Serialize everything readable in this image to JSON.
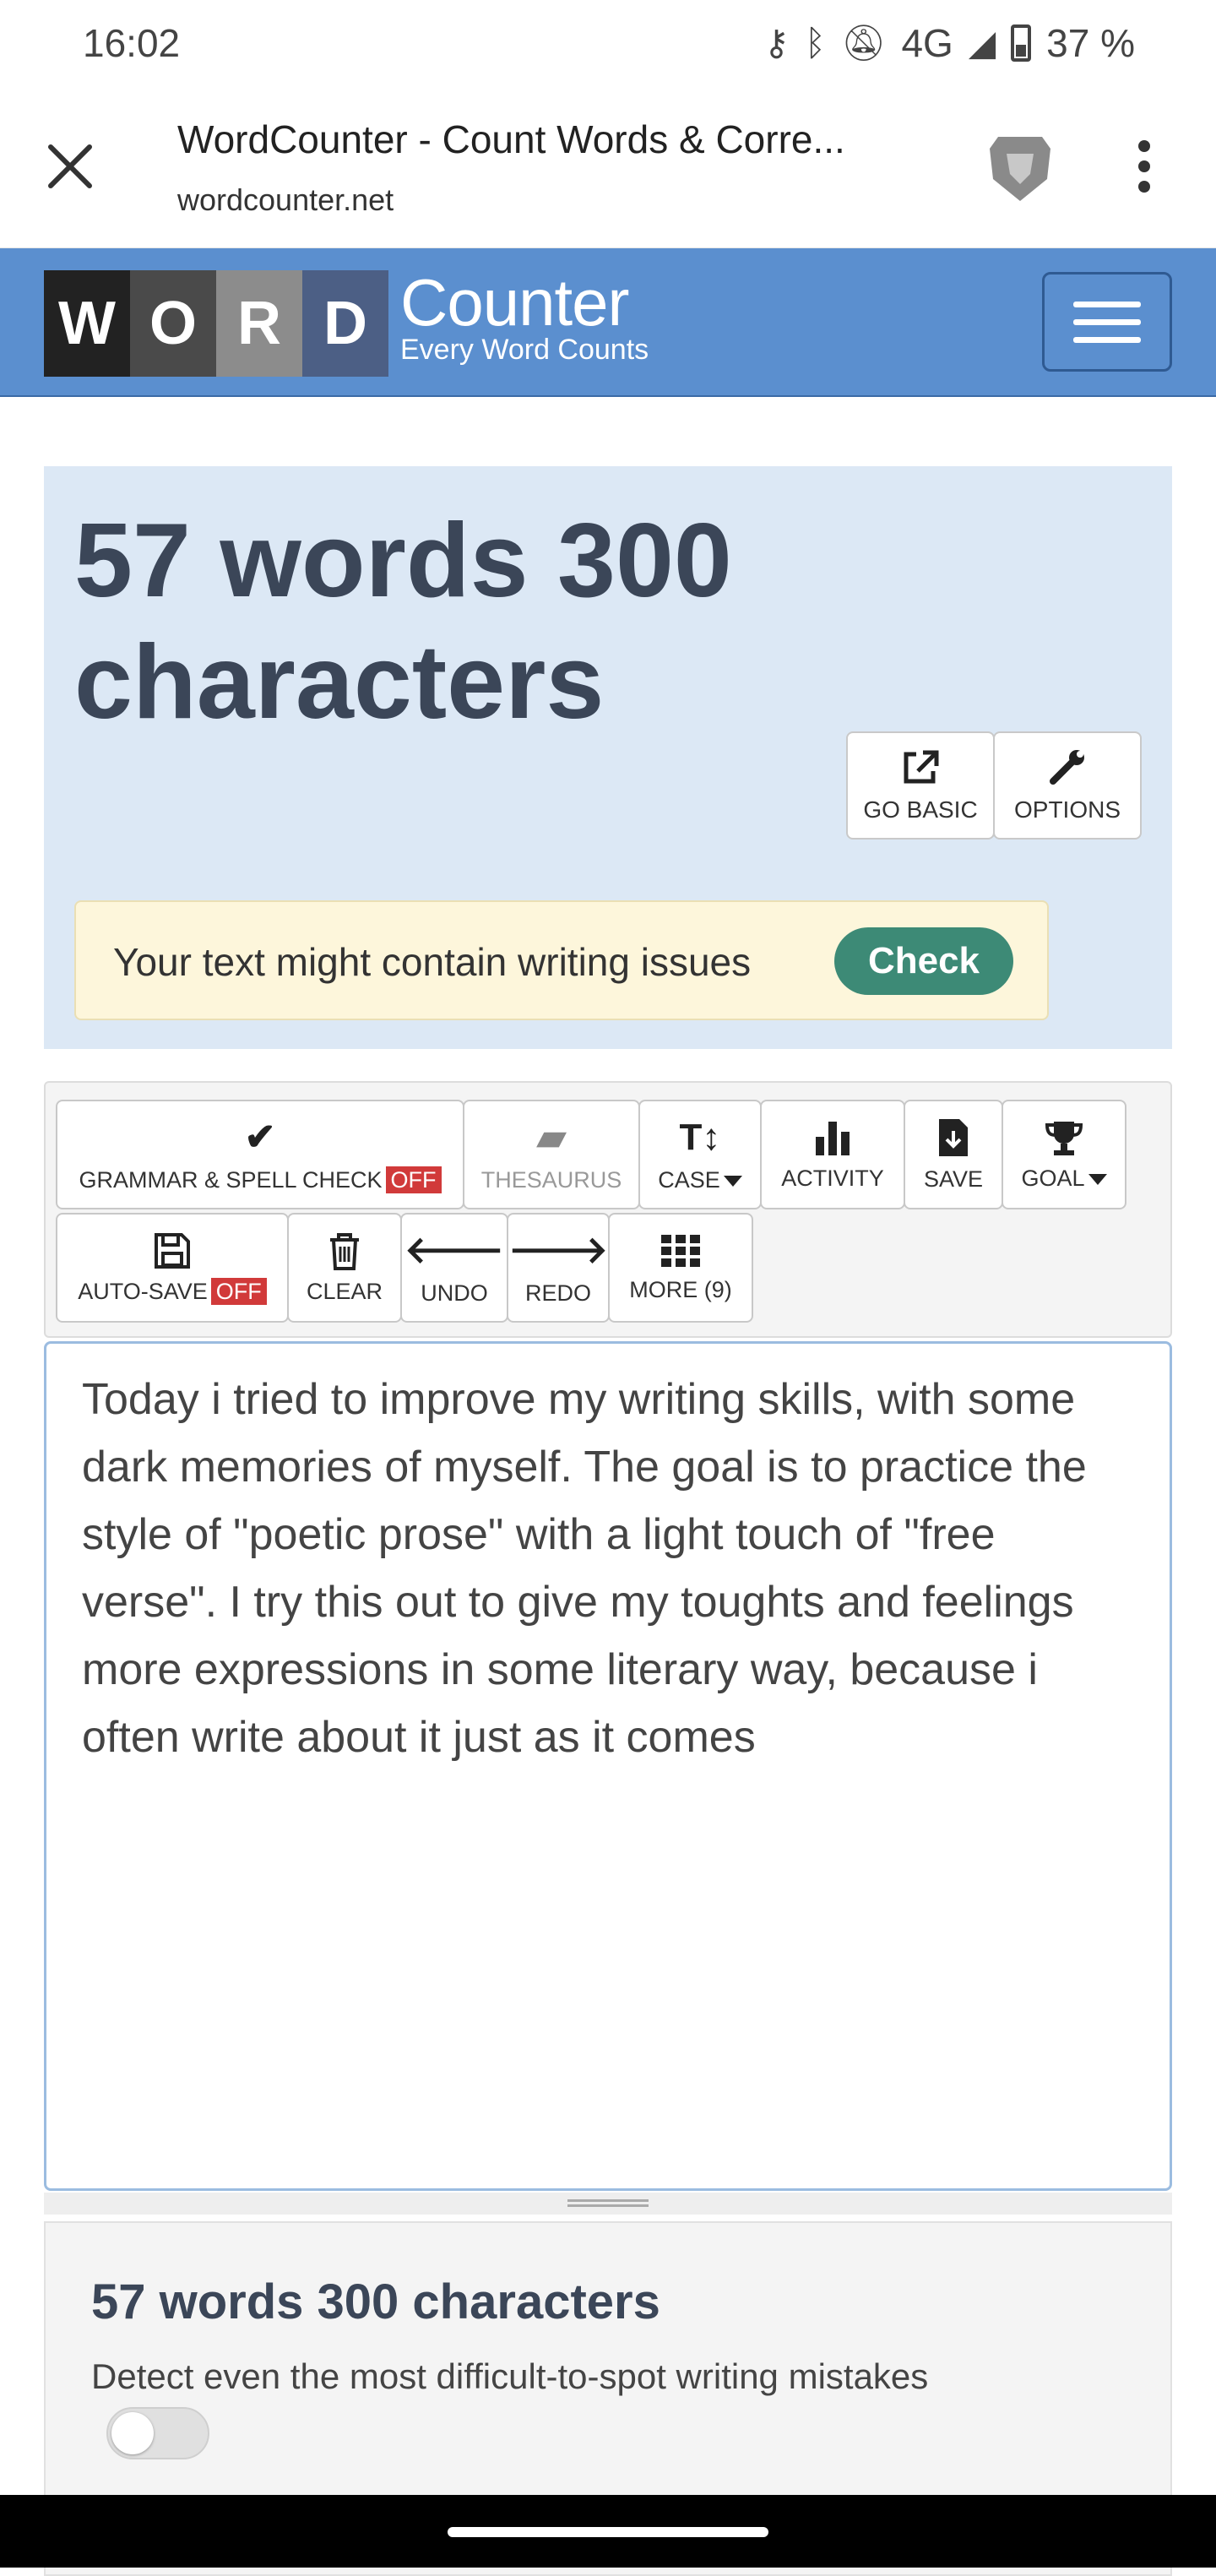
{
  "status_bar": {
    "time": "16:02",
    "network": "4G",
    "battery": "37 %",
    "icons": [
      "key-icon",
      "bluetooth-icon",
      "mute-icon",
      "signal-icon",
      "battery-icon"
    ]
  },
  "browser": {
    "title": "WordCounter - Count Words & Corre...",
    "url": "wordcounter.net"
  },
  "site_header": {
    "logo_letters": [
      "W",
      "O",
      "R",
      "D"
    ],
    "logo_word": "Counter",
    "logo_tagline": "Every Word Counts"
  },
  "counts": {
    "headline": "57 words 300 characters"
  },
  "top_buttons": {
    "go_basic": "GO BASIC",
    "options": "OPTIONS"
  },
  "issues": {
    "text": "Your text might contain writing issues",
    "check": "Check"
  },
  "toolbar": {
    "grammar": "GRAMMAR & SPELL CHECK",
    "grammar_state": "OFF",
    "thesaurus": "THESAURUS",
    "case": "CASE",
    "activity": "ACTIVITY",
    "save": "SAVE",
    "goal": "GOAL",
    "autosave": "AUTO-SAVE",
    "autosave_state": "OFF",
    "clear": "CLEAR",
    "undo": "UNDO",
    "redo": "REDO",
    "more": "MORE (9)"
  },
  "editor": {
    "text": "Today i tried to improve my writing skills, with some dark memories of myself. The goal is to practice the style of \"poetic prose\" with a light touch of \"free verse\". I try this out to give my toughts and feelings more expressions in some literary way, because i often write about it just as it comes"
  },
  "bottom_panel": {
    "title": "57 words 300 characters",
    "subtitle": "Detect even the most difficult-to-spot writing mistakes",
    "toggle_on": false
  }
}
